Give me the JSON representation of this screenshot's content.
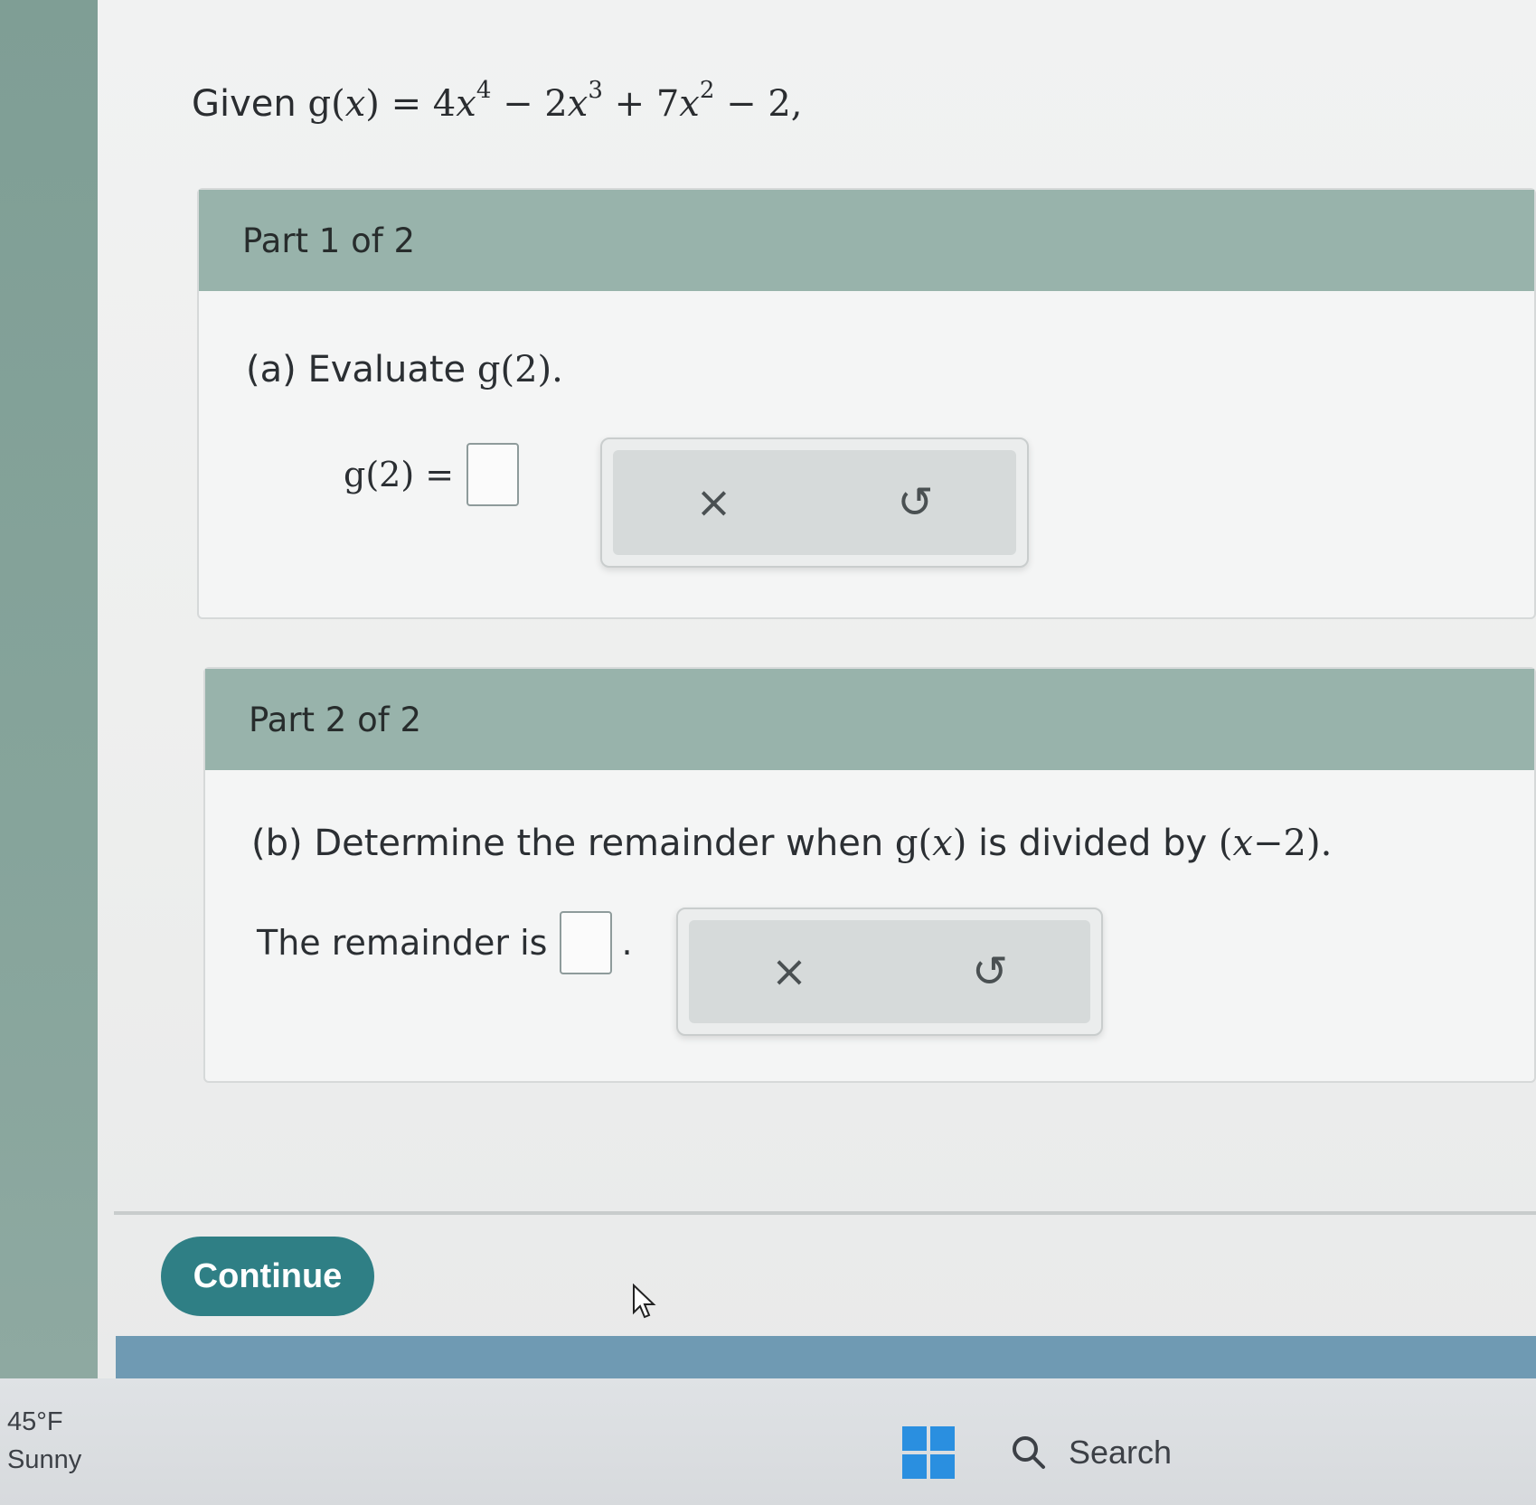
{
  "problem": {
    "given_prefix": "Given"
  },
  "part1": {
    "header": "Part 1 of 2",
    "question_prefix": "(a) Evaluate",
    "answer_value": ""
  },
  "part2": {
    "header": "Part 2 of 2",
    "question_prefix": "(b) Determine the remainder when",
    "question_mid": "is divided by",
    "answer_prefix": "The remainder is",
    "answer_suffix": ".",
    "answer_value": ""
  },
  "tools": {
    "clear_symbol": "×",
    "undo_symbol": "↺",
    "clear_icon": "close-icon",
    "undo_icon": "undo-icon"
  },
  "actions": {
    "continue_label": "Continue"
  },
  "taskbar": {
    "temperature": "45°F",
    "condition": "Sunny",
    "search_label": "Search"
  },
  "colors": {
    "part_header": "#98b3ab",
    "continue_button": "#2f7f85",
    "windows_logo": "#2a8fe0"
  }
}
